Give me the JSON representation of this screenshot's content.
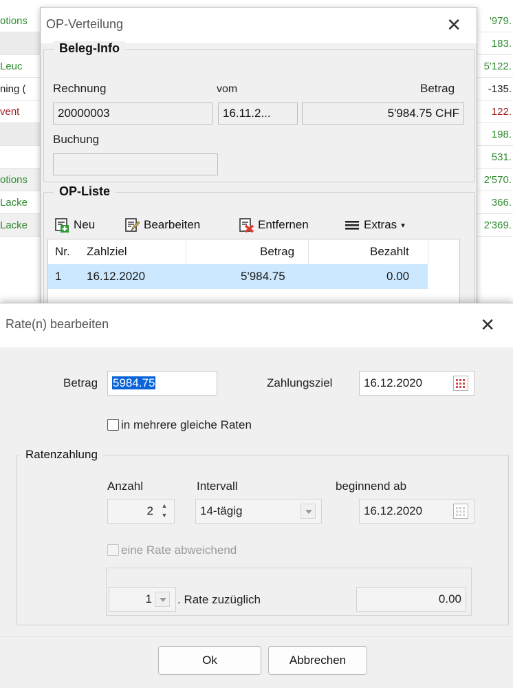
{
  "background": {
    "left_column": [
      {
        "text": "otions",
        "color": "#2e8b2e",
        "bg": "#ffffff"
      },
      {
        "text": "",
        "color": "#1a1a1a",
        "bg": "#ececec"
      },
      {
        "text": "Leuc",
        "color": "#2e8b2e",
        "bg": "#ffffff"
      },
      {
        "text": "ning (",
        "color": "#1a1a1a",
        "bg": "#ffffff"
      },
      {
        "text": "vent",
        "color": "#9c1c1c",
        "bg": "#ffffff"
      },
      {
        "text": "",
        "color": "#1a1a1a",
        "bg": "#ececec"
      },
      {
        "text": "",
        "color": "#1a1a1a",
        "bg": "#ffffff"
      },
      {
        "text": "otions",
        "color": "#2e8b2e",
        "bg": "#f0f0f0"
      },
      {
        "text": "Lacke",
        "color": "#2e8b2e",
        "bg": "#ffffff"
      },
      {
        "text": "Lacke",
        "color": "#2e8b2e",
        "bg": "#f0f0f0"
      }
    ],
    "right_column": [
      {
        "text": "'979.",
        "color": "#2e8b2e"
      },
      {
        "text": "183.",
        "color": "#2e8b2e"
      },
      {
        "text": "5'122.",
        "color": "#2e8b2e"
      },
      {
        "text": "-135.",
        "color": "#1a1a1a"
      },
      {
        "text": "122.",
        "color": "#9c1c1c"
      },
      {
        "text": "198.",
        "color": "#2e8b2e"
      },
      {
        "text": "531.",
        "color": "#2e8b2e"
      },
      {
        "text": "2'570.",
        "color": "#2e8b2e"
      },
      {
        "text": "366.",
        "color": "#2e8b2e"
      },
      {
        "text": "2'369.",
        "color": "#2e8b2e"
      }
    ]
  },
  "op_dialog": {
    "title": "OP-Verteilung",
    "close_glyph": "✕",
    "beleg_info": {
      "legend": "Beleg-Info",
      "rechnung_label": "Rechnung",
      "vom_label": "vom",
      "betrag_label": "Betrag",
      "rechnung_value": "20000003",
      "vom_value": "16.11.2...",
      "betrag_value": "5'984.75 CHF",
      "buchung_label": "Buchung",
      "buchung_value": ""
    },
    "op_liste": {
      "legend": "OP-Liste",
      "toolbar": {
        "neu": "Neu",
        "bearbeiten": "Bearbeiten",
        "entfernen": "Entfernen",
        "extras": "Extras",
        "extras_arrow": "▾"
      },
      "columns": [
        "Nr.",
        "Zahlziel",
        "Betrag",
        "Bezahlt"
      ],
      "rows": [
        {
          "nr": "1",
          "zahlziel": "16.12.2020",
          "betrag": "5'984.75",
          "bezahlt": "0.00"
        }
      ]
    }
  },
  "rate_dialog": {
    "title": "Rate(n) bearbeiten",
    "close_glyph": "✕",
    "betrag_label": "Betrag",
    "betrag_value": "5984.75",
    "zahlungsziel_label": "Zahlungsziel",
    "zahlungsziel_value": "16.12.2020",
    "mehrere_raten_label": "in mehrere gleiche Raten",
    "ratenzahlung": {
      "legend": "Ratenzahlung",
      "anzahl_label": "Anzahl",
      "anzahl_value": "2",
      "intervall_label": "Intervall",
      "intervall_value": "14-tägig",
      "beginnend_label": "beginnend ab",
      "beginnend_value": "16.12.2020",
      "abweichend_label": "eine Rate abweichend",
      "rate_nr_value": "1",
      "rate_zuzueglich_label": ". Rate zuzüglich",
      "zuzueglich_value": "0.00"
    },
    "ok_label": "Ok",
    "abbrechen_label": "Abbrechen"
  },
  "colors": {
    "selection_row": "#cce8ff",
    "text_selection": "#0a64d8",
    "green_text": "#2e8b2e",
    "red_text": "#9c1c1c"
  }
}
